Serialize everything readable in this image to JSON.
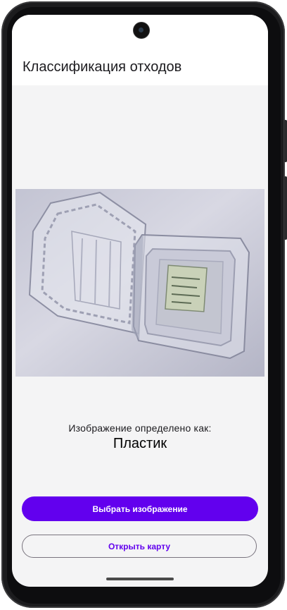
{
  "app_bar": {
    "title": "Классификация отходов"
  },
  "image_view": {
    "description_icon": "plastic-container-photo"
  },
  "result": {
    "label": "Изображение определено как:",
    "value": "Пластик"
  },
  "actions": {
    "pick_image_label": "Выбрать изображение",
    "open_map_label": "Открыть карту"
  },
  "colors": {
    "primary": "#6200ee",
    "background": "#f4f4f5",
    "app_bar": "#ffffff",
    "outline": "#79747e"
  }
}
